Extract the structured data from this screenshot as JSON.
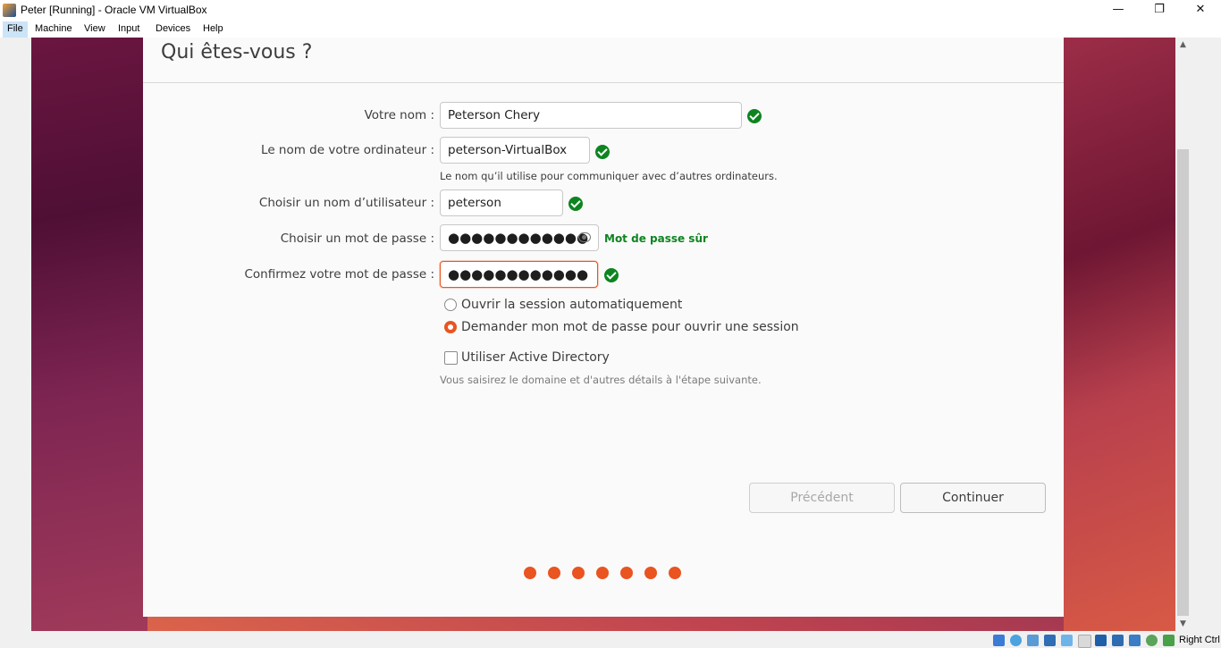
{
  "window": {
    "title": "Peter [Running] - Oracle VM VirtualBox",
    "controls": {
      "minimize": "—",
      "restore": "❐",
      "close": "✕"
    }
  },
  "menu": [
    "File",
    "Machine",
    "View",
    "Input",
    "Devices",
    "Help"
  ],
  "installer": {
    "title": "Qui êtes-vous ?",
    "fields": {
      "name": {
        "label": "Votre nom :",
        "value": "Peterson Chery"
      },
      "computer": {
        "label": "Le nom de votre ordinateur :",
        "value": "peterson-VirtualBox",
        "hint": "Le nom qu’il utilise pour communiquer avec d’autres ordinateurs."
      },
      "username": {
        "label": "Choisir un nom d’utilisateur :",
        "value": "peterson"
      },
      "password": {
        "label": "Choisir un mot de passe :",
        "value": "●●●●●●●●●●●●",
        "strength": "Mot de passe sûr"
      },
      "confirm": {
        "label": "Confirmez votre mot de passe :",
        "value": "●●●●●●●●●●●●"
      }
    },
    "login_options": {
      "auto": "Ouvrir la session automatiquement",
      "ask": "Demander mon mot de passe pour ouvrir une session",
      "selected": "ask"
    },
    "active_directory": {
      "label": "Utiliser Active Directory",
      "checked": false,
      "hint": "Vous saisirez le domaine et d'autres détails à l'étape suivante."
    },
    "buttons": {
      "back": "Précédent",
      "continue": "Continuer"
    },
    "progress": {
      "steps": 7,
      "accent": "#e95420"
    }
  },
  "statusbar": {
    "host_key": "Right Ctrl"
  },
  "colors": {
    "accent": "#e95420",
    "ok": "#0e8420"
  }
}
